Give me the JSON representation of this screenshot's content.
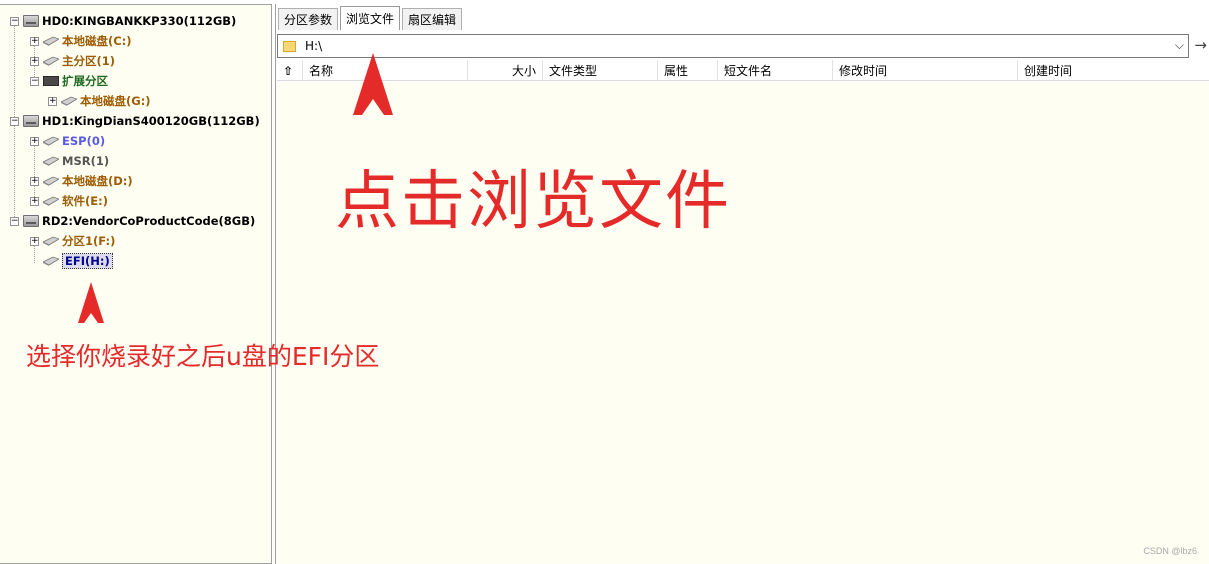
{
  "tree": {
    "items": [
      {
        "label": "HD0:KINGBANKKP330(112GB)",
        "kind": "disk"
      },
      {
        "label": "本地磁盘(C:)",
        "kind": "drive"
      },
      {
        "label": "主分区(1)",
        "kind": "drive"
      },
      {
        "label": "扩展分区",
        "kind": "extended"
      },
      {
        "label": "本地磁盘(G:)",
        "kind": "drive"
      },
      {
        "label": "HD1:KingDianS400120GB(112GB)",
        "kind": "disk"
      },
      {
        "label": "ESP(0)",
        "kind": "drive"
      },
      {
        "label": "MSR(1)",
        "kind": "drive"
      },
      {
        "label": "本地磁盘(D:)",
        "kind": "drive"
      },
      {
        "label": "软件(E:)",
        "kind": "drive"
      },
      {
        "label": "RD2:VendorCoProductCode(8GB)",
        "kind": "disk"
      },
      {
        "label": "分区1(F:)",
        "kind": "drive"
      },
      {
        "label": "EFI(H:)",
        "kind": "drive",
        "selected": true
      }
    ]
  },
  "tabs": [
    {
      "label": "分区参数"
    },
    {
      "label": "浏览文件",
      "active": true
    },
    {
      "label": "扇区编辑"
    }
  ],
  "path": {
    "value": "H:\\"
  },
  "columns": {
    "name": "名称",
    "size": "大小",
    "type": "文件类型",
    "attr": "属性",
    "short_name": "短文件名",
    "modified": "修改时间",
    "created": "创建时间"
  },
  "annotations": {
    "click_tab": "点击浏览文件",
    "select_efi": "选择你烧录好之后u盘的EFI分区"
  },
  "watermark": "CSDN @lbz6",
  "colors": {
    "annotation": "#e52a2a",
    "pane_bg": "#fefef3",
    "drive_label": "#9e5d05",
    "extended_label": "#1f6a1f",
    "esp_label": "#5a5ae8",
    "selected_label": "#00008b"
  }
}
